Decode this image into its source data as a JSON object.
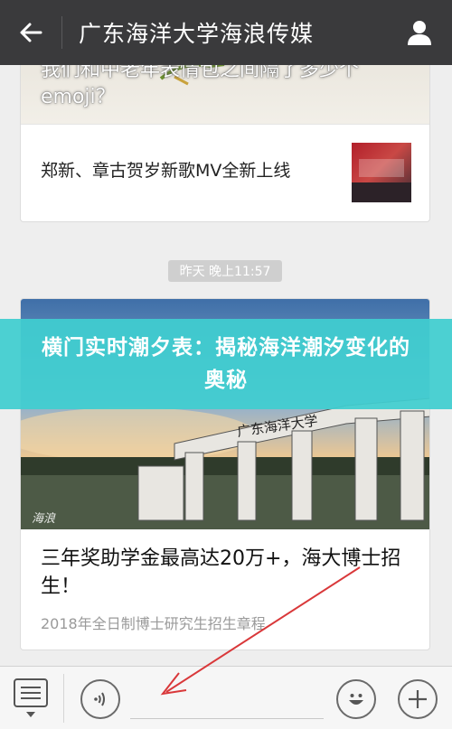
{
  "header": {
    "title": "广东海洋大学海浪传媒",
    "back_icon": "arrow-left-icon",
    "profile_icon": "person-icon"
  },
  "feed": {
    "card1": {
      "top_title": "我们和中老年表情包之间隔了多少个emoji？",
      "row_title": "郑新、章古贺岁新歌MV全新上线"
    },
    "timestamp": "昨天 晚上11:57",
    "card2": {
      "image_watermark": "海浪",
      "image_sign": "广东海洋大学",
      "title": "三年奖助学金最高达20万+，海大博士招生！",
      "subtitle": "2018年全日制博士研究生招生章程"
    }
  },
  "banner": {
    "text": "横门实时潮夕表：揭秘海洋潮汐变化的奥秘"
  },
  "bottom_bar": {
    "menu_icon": "menu-list-icon",
    "voice_icon": "voice-icon",
    "emoji_icon": "emoji-icon",
    "plus_icon": "plus-icon",
    "input_value": ""
  },
  "colors": {
    "topbar": "#3a3a3c",
    "banner": "#40ced0",
    "arrow": "#d9383a"
  }
}
